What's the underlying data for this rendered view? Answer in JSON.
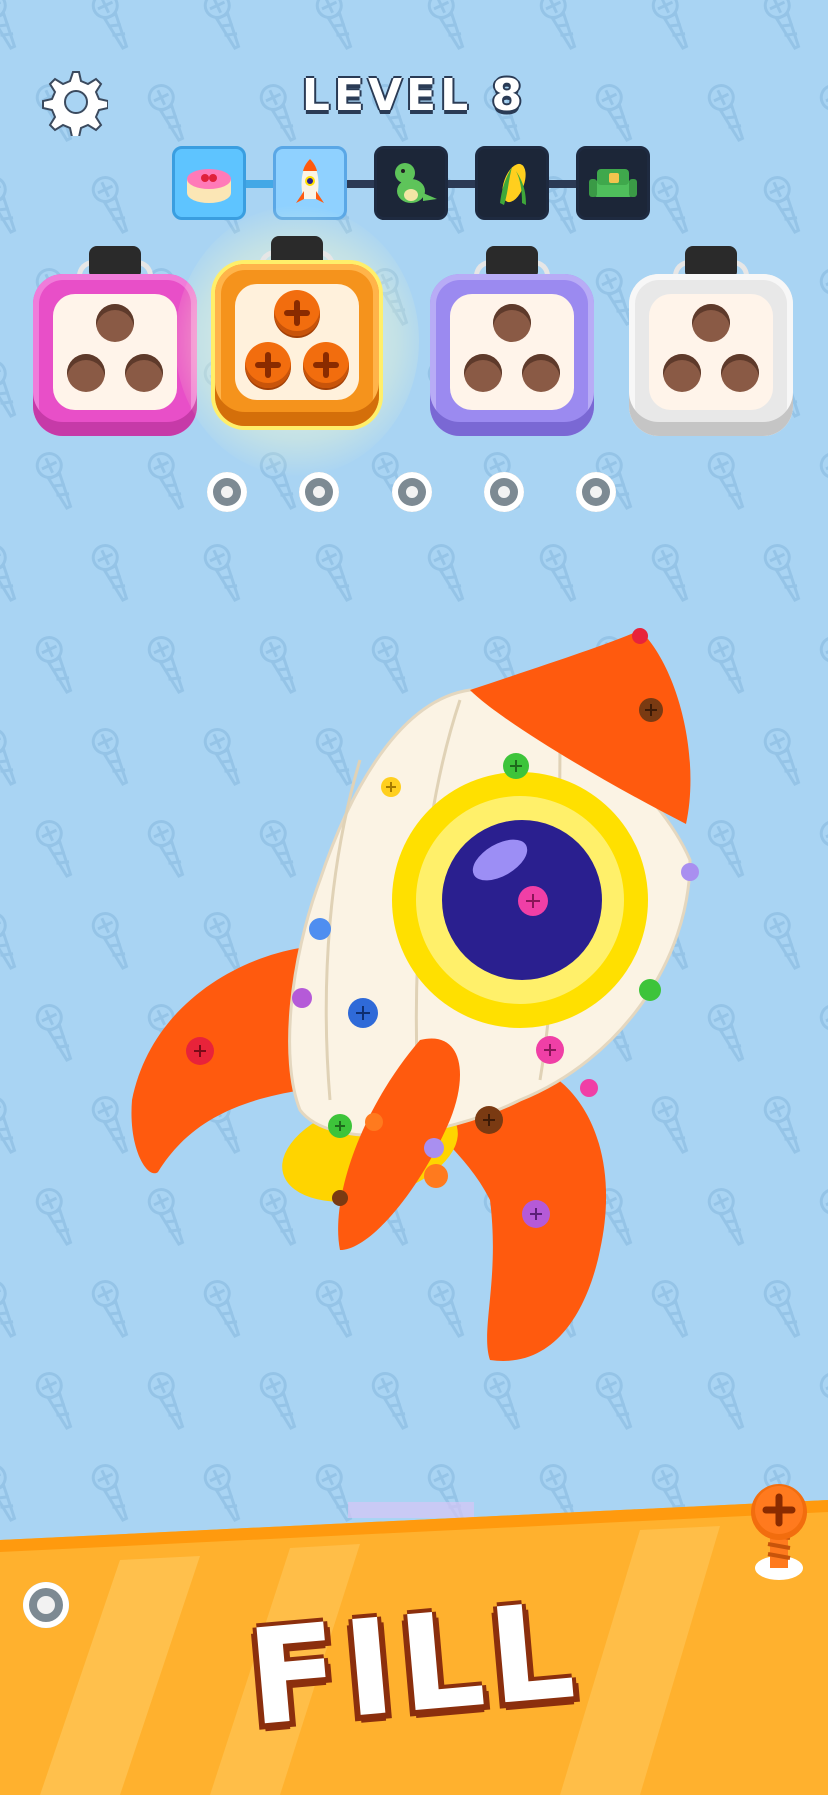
{
  "game": {
    "level_title": "LEVEL 8",
    "action_label": "FILL"
  },
  "icons": {
    "settings": "gear-icon",
    "stages": [
      "cake-icon",
      "rocket-icon",
      "dinosaur-icon",
      "corn-icon",
      "sofa-icon"
    ]
  },
  "progress": {
    "stages_total": 5,
    "current_stage": 2,
    "completed_stages": 1
  },
  "boxes": [
    {
      "color": "pink",
      "hex": "#e84fc8",
      "holes": 3,
      "filled": 0
    },
    {
      "color": "orange",
      "hex": "#f5931c",
      "holes": 3,
      "filled": 3,
      "highlighted": true
    },
    {
      "color": "purple",
      "hex": "#9b8af0",
      "holes": 3,
      "filled": 0
    },
    {
      "color": "white",
      "hex": "#e8e8e8",
      "holes": 3,
      "filled": 0
    }
  ],
  "holding_slots": {
    "count": 5,
    "filled": 0
  },
  "colors": {
    "background": "#a9d4f3",
    "rocket_orange": "#ff5a0e",
    "rocket_body": "#fbf3e4",
    "window_ring": "#ffe000",
    "window_glass": "#2a1f8f",
    "fill_bar": "#ffb12e"
  }
}
